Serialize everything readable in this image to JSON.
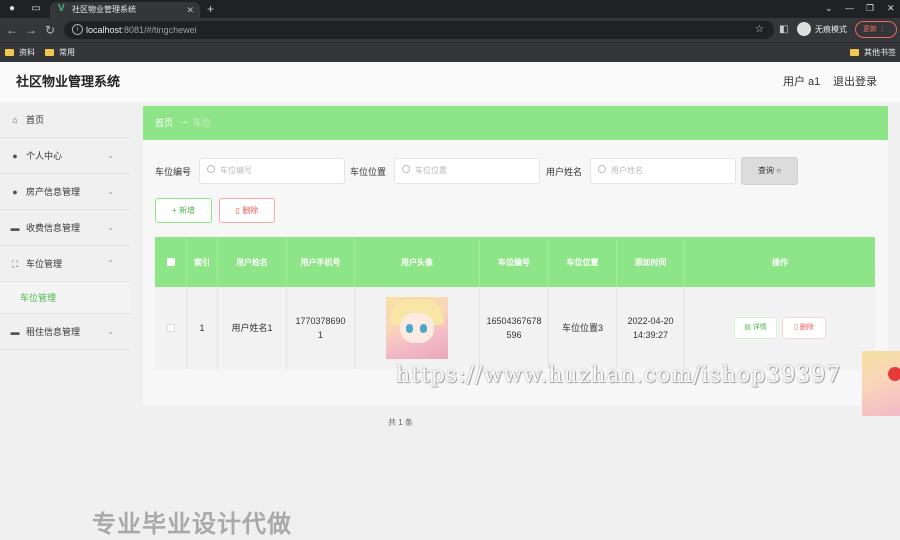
{
  "browser": {
    "tab_title": "社区物业管理系统",
    "url_host": "localhost",
    "url_path": ":8081/#/tingchewei",
    "incognito_label": "无痕模式",
    "update_label": "更新",
    "bookmarks": [
      "资料",
      "常用",
      "其他书签"
    ]
  },
  "app": {
    "title": "社区物业管理系统",
    "user_label": "用户 a1",
    "logout_label": "退出登录"
  },
  "sidebar": {
    "items": [
      {
        "label": "首页",
        "icon": "home-icon"
      },
      {
        "label": "个人中心",
        "icon": "user-icon"
      },
      {
        "label": "房产信息管理",
        "icon": "user-icon"
      },
      {
        "label": "收费信息管理",
        "icon": "monitor-icon"
      },
      {
        "label": "车位管理",
        "icon": "frame-icon"
      },
      {
        "label": "租住信息管理",
        "icon": "monitor-icon"
      }
    ],
    "submenu_label": "车位管理"
  },
  "breadcrumb": {
    "home": "首页",
    "separator": "→",
    "current": "车位"
  },
  "search": {
    "fields": [
      {
        "label": "车位编号",
        "placeholder": "车位编号"
      },
      {
        "label": "车位位置",
        "placeholder": "车位位置"
      },
      {
        "label": "用户姓名",
        "placeholder": "用户姓名"
      }
    ],
    "query_label": "查询"
  },
  "toolbar": {
    "add_label": "新增",
    "delete_label": "删除"
  },
  "table": {
    "headers": [
      "索引",
      "用户姓名",
      "用户手机号",
      "用户头像",
      "车位编号",
      "车位位置",
      "添加时间",
      "操作"
    ],
    "rows": [
      {
        "index": "1",
        "name": "用户姓名1",
        "phone": "17703786901",
        "plate": "16504367678596",
        "location": "车位位置3",
        "added": "2022-04-20 14:39:27",
        "detail_label": "详情",
        "delete_label": "删除"
      }
    ]
  },
  "pager": {
    "text": "共 1 条"
  },
  "overlay": {
    "watermark": "https://www.huzhan.com/ishop39397",
    "promo": "专业毕业设计代做"
  },
  "colors": {
    "accent": "#8ee587",
    "accent_text": "#49b749",
    "danger": "#e85c5c"
  }
}
